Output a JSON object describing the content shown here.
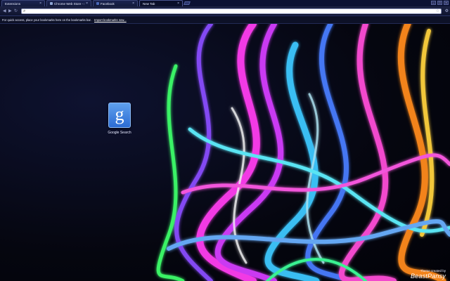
{
  "tabs": [
    {
      "title": "Extensions",
      "active": false
    },
    {
      "title": "Chrome Web Store - stan",
      "active": false
    },
    {
      "title": "Facebook",
      "active": false
    },
    {
      "title": "New Tab",
      "active": true
    }
  ],
  "toolbar": {
    "omnibox_value": "",
    "icons": [
      "back-icon",
      "forward-icon",
      "reload-icon",
      "search-icon",
      "star-icon",
      "wrench-icon"
    ]
  },
  "bookmarks_bar": {
    "message": "For quick access, place your bookmarks here on the bookmarks bar.",
    "import_link": "Import bookmarks now..."
  },
  "apps": [
    {
      "label": "Google Search",
      "icon_glyph": "g"
    }
  ],
  "theme_credit": {
    "line1": "Theme created by",
    "line2": "BeastPansy"
  },
  "colors": {
    "chrome_frame": "#0c1233",
    "app_icon_blue": "#3b7ddd"
  }
}
